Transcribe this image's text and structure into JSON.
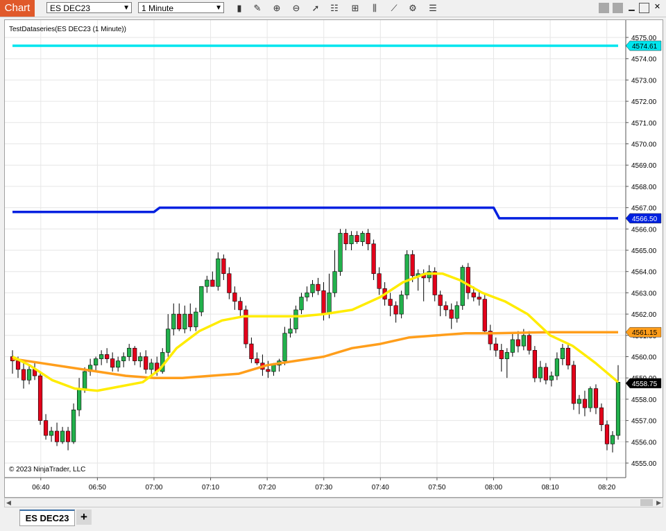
{
  "window": {
    "title_tab": "Chart",
    "instrument": "ES DEC23",
    "interval": "1 Minute",
    "toolbar_icons": [
      "bars-type-icon",
      "pencil-draw-icon",
      "zoom-in-icon",
      "zoom-out-icon",
      "pointer-icon",
      "properties-icon",
      "template-icon",
      "indicators-icon",
      "strategies-icon",
      "chart-trader-icon",
      "list-icon"
    ],
    "window_controls": [
      "gray-square-icon",
      "gray-square-icon",
      "minimize-icon",
      "maximize-icon",
      "close-icon"
    ]
  },
  "chart": {
    "indicator_label": "TestDataseries(ES DEC23 (1 Minute))",
    "copyright": "© 2023 NinjaTrader, LLC",
    "tabs": [
      {
        "label": "ES DEC23"
      }
    ],
    "add_tab_label": "+"
  },
  "chart_data": {
    "type": "candlestick",
    "title": "TestDataseries(ES DEC23 (1 Minute))",
    "ylim": [
      4554.6,
      4575.6
    ],
    "y_ticks": [
      "4555.00",
      "4556.00",
      "4557.00",
      "4558.00",
      "4559.00",
      "4560.00",
      "4561.00",
      "4562.00",
      "4563.00",
      "4564.00",
      "4565.00",
      "4566.00",
      "4567.00",
      "4568.00",
      "4569.00",
      "4570.00",
      "4571.00",
      "4572.00",
      "4573.00",
      "4574.00",
      "4575.00"
    ],
    "x_ticks": [
      "06:40",
      "06:50",
      "07:00",
      "07:10",
      "07:20",
      "07:30",
      "07:40",
      "07:50",
      "08:00",
      "08:10",
      "08:20"
    ],
    "start_minute": 395,
    "end_minute": 502,
    "candles": [
      {
        "o": 4560.0,
        "h": 4560.3,
        "l": 4559.2,
        "c": 4559.8
      },
      {
        "o": 4559.8,
        "h": 4560.0,
        "l": 4559.0,
        "c": 4559.4
      },
      {
        "o": 4559.4,
        "h": 4559.7,
        "l": 4558.5,
        "c": 4558.9
      },
      {
        "o": 4558.9,
        "h": 4559.6,
        "l": 4558.7,
        "c": 4559.4
      },
      {
        "o": 4559.4,
        "h": 4559.7,
        "l": 4558.9,
        "c": 4559.1
      },
      {
        "o": 4559.1,
        "h": 4559.3,
        "l": 4556.8,
        "c": 4557.0
      },
      {
        "o": 4557.0,
        "h": 4557.3,
        "l": 4556.1,
        "c": 4556.3
      },
      {
        "o": 4556.3,
        "h": 4556.7,
        "l": 4556.0,
        "c": 4556.5
      },
      {
        "o": 4556.5,
        "h": 4556.9,
        "l": 4555.8,
        "c": 4556.0
      },
      {
        "o": 4556.0,
        "h": 4556.7,
        "l": 4555.9,
        "c": 4556.5
      },
      {
        "o": 4556.5,
        "h": 4556.7,
        "l": 4555.6,
        "c": 4556.0
      },
      {
        "o": 4556.0,
        "h": 4557.8,
        "l": 4555.9,
        "c": 4557.5
      },
      {
        "o": 4557.5,
        "h": 4559.0,
        "l": 4557.2,
        "c": 4558.5
      },
      {
        "o": 4558.5,
        "h": 4559.5,
        "l": 4558.3,
        "c": 4559.3
      },
      {
        "o": 4559.3,
        "h": 4559.9,
        "l": 4559.1,
        "c": 4559.6
      },
      {
        "o": 4559.6,
        "h": 4560.0,
        "l": 4559.3,
        "c": 4559.9
      },
      {
        "o": 4559.9,
        "h": 4560.3,
        "l": 4559.6,
        "c": 4560.1
      },
      {
        "o": 4560.1,
        "h": 4560.4,
        "l": 4559.7,
        "c": 4559.9
      },
      {
        "o": 4559.9,
        "h": 4560.2,
        "l": 4559.3,
        "c": 4559.5
      },
      {
        "o": 4559.5,
        "h": 4560.0,
        "l": 4559.3,
        "c": 4559.8
      },
      {
        "o": 4559.8,
        "h": 4560.2,
        "l": 4559.5,
        "c": 4560.0
      },
      {
        "o": 4560.0,
        "h": 4560.6,
        "l": 4559.8,
        "c": 4560.4
      },
      {
        "o": 4560.4,
        "h": 4560.5,
        "l": 4559.6,
        "c": 4559.8
      },
      {
        "o": 4559.8,
        "h": 4560.2,
        "l": 4559.5,
        "c": 4560.0
      },
      {
        "o": 4560.0,
        "h": 4560.3,
        "l": 4559.2,
        "c": 4559.4
      },
      {
        "o": 4559.4,
        "h": 4559.9,
        "l": 4559.0,
        "c": 4559.7
      },
      {
        "o": 4559.7,
        "h": 4560.0,
        "l": 4559.1,
        "c": 4559.3
      },
      {
        "o": 4559.3,
        "h": 4560.4,
        "l": 4559.2,
        "c": 4560.2
      },
      {
        "o": 4560.2,
        "h": 4562.0,
        "l": 4560.0,
        "c": 4561.3
      },
      {
        "o": 4561.3,
        "h": 4562.5,
        "l": 4561.0,
        "c": 4562.0
      },
      {
        "o": 4562.0,
        "h": 4562.5,
        "l": 4561.2,
        "c": 4561.3
      },
      {
        "o": 4561.3,
        "h": 4562.4,
        "l": 4561.1,
        "c": 4562.0
      },
      {
        "o": 4562.0,
        "h": 4562.5,
        "l": 4561.2,
        "c": 4561.4
      },
      {
        "o": 4561.4,
        "h": 4562.3,
        "l": 4561.2,
        "c": 4562.1
      },
      {
        "o": 4562.1,
        "h": 4563.3,
        "l": 4561.9,
        "c": 4563.3
      },
      {
        "o": 4563.3,
        "h": 4563.8,
        "l": 4563.0,
        "c": 4563.6
      },
      {
        "o": 4563.6,
        "h": 4564.0,
        "l": 4563.3,
        "c": 4563.3
      },
      {
        "o": 4563.3,
        "h": 4564.9,
        "l": 4563.1,
        "c": 4564.6
      },
      {
        "o": 4564.6,
        "h": 4564.8,
        "l": 4563.6,
        "c": 4563.9
      },
      {
        "o": 4563.9,
        "h": 4564.2,
        "l": 4562.7,
        "c": 4563.0
      },
      {
        "o": 4563.0,
        "h": 4563.3,
        "l": 4562.2,
        "c": 4562.6
      },
      {
        "o": 4562.6,
        "h": 4562.8,
        "l": 4561.9,
        "c": 4562.2
      },
      {
        "o": 4562.2,
        "h": 4562.4,
        "l": 4560.4,
        "c": 4560.6
      },
      {
        "o": 4560.6,
        "h": 4560.9,
        "l": 4559.7,
        "c": 4559.9
      },
      {
        "o": 4559.9,
        "h": 4560.2,
        "l": 4559.6,
        "c": 4559.7
      },
      {
        "o": 4559.7,
        "h": 4560.1,
        "l": 4559.1,
        "c": 4559.4
      },
      {
        "o": 4559.4,
        "h": 4559.8,
        "l": 4559.0,
        "c": 4559.3
      },
      {
        "o": 4559.3,
        "h": 4559.7,
        "l": 4559.1,
        "c": 4559.6
      },
      {
        "o": 4559.6,
        "h": 4559.9,
        "l": 4559.3,
        "c": 4559.8
      },
      {
        "o": 4559.8,
        "h": 4561.4,
        "l": 4559.6,
        "c": 4561.1
      },
      {
        "o": 4561.1,
        "h": 4561.8,
        "l": 4560.9,
        "c": 4561.3
      },
      {
        "o": 4561.3,
        "h": 4562.4,
        "l": 4561.1,
        "c": 4562.2
      },
      {
        "o": 4562.2,
        "h": 4563.0,
        "l": 4562.0,
        "c": 4562.8
      },
      {
        "o": 4562.8,
        "h": 4563.3,
        "l": 4562.6,
        "c": 4563.0
      },
      {
        "o": 4563.0,
        "h": 4563.6,
        "l": 4562.8,
        "c": 4563.4
      },
      {
        "o": 4563.4,
        "h": 4563.7,
        "l": 4562.9,
        "c": 4563.1
      },
      {
        "o": 4563.1,
        "h": 4563.5,
        "l": 4561.7,
        "c": 4562.0
      },
      {
        "o": 4562.0,
        "h": 4563.9,
        "l": 4561.8,
        "c": 4563.0
      },
      {
        "o": 4563.0,
        "h": 4565.0,
        "l": 4562.8,
        "c": 4564.0
      },
      {
        "o": 4564.0,
        "h": 4566.0,
        "l": 4563.8,
        "c": 4565.8
      },
      {
        "o": 4565.8,
        "h": 4566.0,
        "l": 4565.0,
        "c": 4565.3
      },
      {
        "o": 4565.3,
        "h": 4565.9,
        "l": 4565.0,
        "c": 4565.7
      },
      {
        "o": 4565.7,
        "h": 4565.9,
        "l": 4565.3,
        "c": 4565.4
      },
      {
        "o": 4565.4,
        "h": 4565.9,
        "l": 4565.2,
        "c": 4565.8
      },
      {
        "o": 4565.8,
        "h": 4566.0,
        "l": 4565.0,
        "c": 4565.3
      },
      {
        "o": 4565.3,
        "h": 4565.5,
        "l": 4563.6,
        "c": 4563.9
      },
      {
        "o": 4563.9,
        "h": 4564.2,
        "l": 4562.9,
        "c": 4563.2
      },
      {
        "o": 4563.2,
        "h": 4563.5,
        "l": 4562.4,
        "c": 4562.7
      },
      {
        "o": 4562.7,
        "h": 4563.0,
        "l": 4561.9,
        "c": 4562.4
      },
      {
        "o": 4562.4,
        "h": 4562.6,
        "l": 4561.6,
        "c": 4562.0
      },
      {
        "o": 4562.0,
        "h": 4563.1,
        "l": 4561.8,
        "c": 4562.9
      },
      {
        "o": 4562.9,
        "h": 4565.0,
        "l": 4562.7,
        "c": 4564.8
      },
      {
        "o": 4564.8,
        "h": 4565.0,
        "l": 4563.5,
        "c": 4563.8
      },
      {
        "o": 4563.8,
        "h": 4564.1,
        "l": 4563.1,
        "c": 4563.9
      },
      {
        "o": 4563.9,
        "h": 4564.1,
        "l": 4562.6,
        "c": 4563.7
      },
      {
        "o": 4563.7,
        "h": 4564.3,
        "l": 4563.5,
        "c": 4564.0
      },
      {
        "o": 4564.0,
        "h": 4564.2,
        "l": 4562.6,
        "c": 4562.9
      },
      {
        "o": 4562.9,
        "h": 4563.1,
        "l": 4561.9,
        "c": 4562.4
      },
      {
        "o": 4562.4,
        "h": 4562.6,
        "l": 4561.9,
        "c": 4562.2
      },
      {
        "o": 4562.2,
        "h": 4562.5,
        "l": 4561.3,
        "c": 4561.8
      },
      {
        "o": 4561.8,
        "h": 4562.6,
        "l": 4561.6,
        "c": 4562.4
      },
      {
        "o": 4562.4,
        "h": 4564.3,
        "l": 4562.2,
        "c": 4564.2
      },
      {
        "o": 4564.2,
        "h": 4564.4,
        "l": 4562.7,
        "c": 4563.0
      },
      {
        "o": 4563.0,
        "h": 4563.3,
        "l": 4562.6,
        "c": 4562.8
      },
      {
        "o": 4562.8,
        "h": 4563.1,
        "l": 4562.4,
        "c": 4562.7
      },
      {
        "o": 4562.7,
        "h": 4563.0,
        "l": 4561.1,
        "c": 4561.2
      },
      {
        "o": 4561.2,
        "h": 4561.5,
        "l": 4560.3,
        "c": 4560.6
      },
      {
        "o": 4560.6,
        "h": 4560.9,
        "l": 4560.0,
        "c": 4560.3
      },
      {
        "o": 4560.3,
        "h": 4560.6,
        "l": 4559.3,
        "c": 4559.9
      },
      {
        "o": 4559.9,
        "h": 4560.4,
        "l": 4559.0,
        "c": 4560.2
      },
      {
        "o": 4560.2,
        "h": 4561.1,
        "l": 4560.0,
        "c": 4560.8
      },
      {
        "o": 4560.8,
        "h": 4561.2,
        "l": 4560.2,
        "c": 4560.5
      },
      {
        "o": 4560.5,
        "h": 4561.3,
        "l": 4560.3,
        "c": 4561.0
      },
      {
        "o": 4561.0,
        "h": 4561.2,
        "l": 4560.1,
        "c": 4560.3
      },
      {
        "o": 4560.3,
        "h": 4560.5,
        "l": 4558.8,
        "c": 4559.0
      },
      {
        "o": 4559.0,
        "h": 4559.8,
        "l": 4558.8,
        "c": 4559.5
      },
      {
        "o": 4559.5,
        "h": 4559.7,
        "l": 4558.7,
        "c": 4558.9
      },
      {
        "o": 4558.9,
        "h": 4559.3,
        "l": 4558.6,
        "c": 4559.1
      },
      {
        "o": 4559.1,
        "h": 4560.2,
        "l": 4558.9,
        "c": 4559.9
      },
      {
        "o": 4559.9,
        "h": 4560.6,
        "l": 4559.6,
        "c": 4560.4
      },
      {
        "o": 4560.4,
        "h": 4560.6,
        "l": 4559.4,
        "c": 4559.6
      },
      {
        "o": 4559.6,
        "h": 4559.8,
        "l": 4557.5,
        "c": 4557.8
      },
      {
        "o": 4557.8,
        "h": 4558.2,
        "l": 4557.3,
        "c": 4558.0
      },
      {
        "o": 4558.0,
        "h": 4558.4,
        "l": 4557.2,
        "c": 4557.6
      },
      {
        "o": 4557.6,
        "h": 4558.6,
        "l": 4557.4,
        "c": 4558.5
      },
      {
        "o": 4558.5,
        "h": 4558.7,
        "l": 4557.3,
        "c": 4557.6
      },
      {
        "o": 4557.6,
        "h": 4557.8,
        "l": 4556.5,
        "c": 4556.8
      },
      {
        "o": 4556.8,
        "h": 4557.0,
        "l": 4555.6,
        "c": 4555.9
      },
      {
        "o": 4555.9,
        "h": 4556.5,
        "l": 4555.5,
        "c": 4556.3
      },
      {
        "o": 4556.3,
        "h": 4559.6,
        "l": 4556.1,
        "c": 4558.8
      }
    ],
    "series": [
      {
        "name": "cyan",
        "color": "#00e5ee",
        "points": [
          [
            395,
            4574.61
          ],
          [
            502,
            4574.61
          ]
        ]
      },
      {
        "name": "blue",
        "color": "#0020e0",
        "points": [
          [
            395,
            4566.8
          ],
          [
            420,
            4566.8
          ],
          [
            421,
            4567.0
          ],
          [
            480,
            4567.0
          ],
          [
            481,
            4566.5
          ],
          [
            502,
            4566.5
          ]
        ]
      },
      {
        "name": "orange",
        "color": "#ff9e1b",
        "points": [
          [
            395,
            4559.9
          ],
          [
            400,
            4559.7
          ],
          [
            405,
            4559.5
          ],
          [
            410,
            4559.3
          ],
          [
            415,
            4559.1
          ],
          [
            420,
            4559.0
          ],
          [
            425,
            4559.0
          ],
          [
            430,
            4559.1
          ],
          [
            435,
            4559.2
          ],
          [
            440,
            4559.6
          ],
          [
            445,
            4559.8
          ],
          [
            450,
            4560.0
          ],
          [
            455,
            4560.4
          ],
          [
            460,
            4560.6
          ],
          [
            465,
            4560.9
          ],
          [
            470,
            4561.0
          ],
          [
            475,
            4561.1
          ],
          [
            480,
            4561.1
          ],
          [
            490,
            4561.15
          ],
          [
            502,
            4561.15
          ]
        ]
      },
      {
        "name": "yellow",
        "color": "#ffec00",
        "points": [
          [
            395,
            4560.0
          ],
          [
            398,
            4559.6
          ],
          [
            402,
            4558.9
          ],
          [
            406,
            4558.5
          ],
          [
            410,
            4558.4
          ],
          [
            414,
            4558.6
          ],
          [
            418,
            4558.8
          ],
          [
            421,
            4559.4
          ],
          [
            424,
            4560.4
          ],
          [
            428,
            4561.2
          ],
          [
            432,
            4561.7
          ],
          [
            436,
            4561.9
          ],
          [
            440,
            4561.9
          ],
          [
            446,
            4561.9
          ],
          [
            450,
            4562.0
          ],
          [
            455,
            4562.2
          ],
          [
            460,
            4562.8
          ],
          [
            464,
            4563.5
          ],
          [
            468,
            4563.9
          ],
          [
            471,
            4563.9
          ],
          [
            474,
            4563.6
          ],
          [
            478,
            4563.0
          ],
          [
            482,
            4562.6
          ],
          [
            486,
            4562.0
          ],
          [
            490,
            4561.0
          ],
          [
            494,
            4560.5
          ],
          [
            498,
            4559.7
          ],
          [
            502,
            4558.8
          ]
        ]
      }
    ],
    "price_markers": [
      {
        "label": "4574.61",
        "value": 4574.61,
        "bg": "#00e5ee",
        "fg": "#000000"
      },
      {
        "label": "4566.50",
        "value": 4566.5,
        "bg": "#0020e0",
        "fg": "#ffffff"
      },
      {
        "label": "4561.15",
        "value": 4561.15,
        "bg": "#ff9e1b",
        "fg": "#000000"
      },
      {
        "label": "4558.75",
        "value": 4558.75,
        "bg": "#000000",
        "fg": "#ffffff"
      }
    ],
    "up_color": "#22b14c",
    "down_color": "#e3001b",
    "grid": true
  }
}
